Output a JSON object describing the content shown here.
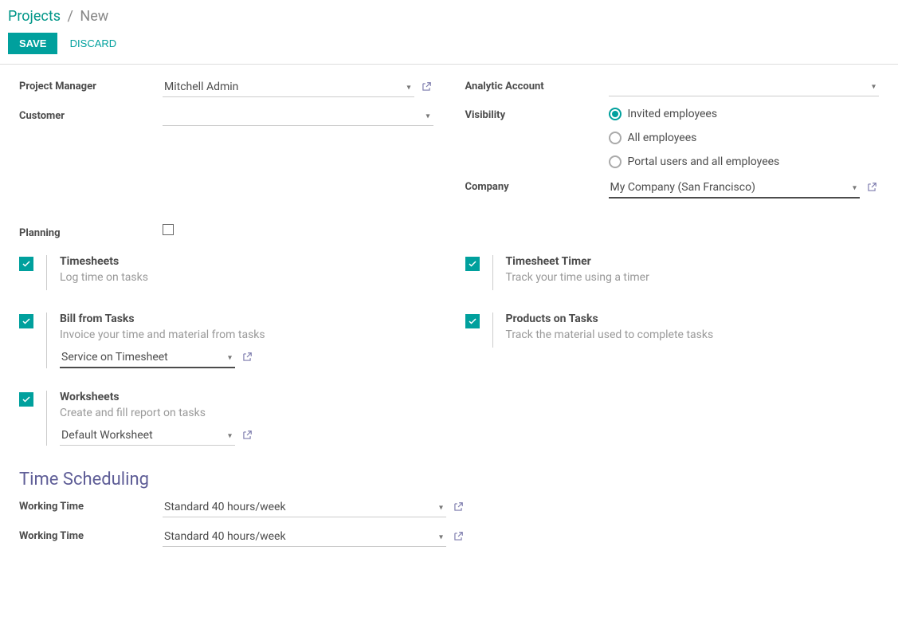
{
  "breadcrumb": {
    "root": "Projects",
    "current": "New"
  },
  "actions": {
    "save": "SAVE",
    "discard": "DISCARD"
  },
  "fields": {
    "project_manager_label": "Project Manager",
    "project_manager": "Mitchell Admin",
    "customer_label": "Customer",
    "customer": "",
    "analytic_account_label": "Analytic Account",
    "analytic_account": "",
    "visibility_label": "Visibility",
    "visibility_options": {
      "invited": "Invited employees",
      "all": "All employees",
      "portal": "Portal users and all employees"
    },
    "visibility_selected": "invited",
    "company_label": "Company",
    "company": "My Company (San Francisco)",
    "planning_label": "Planning"
  },
  "settings": {
    "timesheets": {
      "title": "Timesheets",
      "desc": "Log time on tasks"
    },
    "timesheet_timer": {
      "title": "Timesheet Timer",
      "desc": "Track your time using a timer"
    },
    "bill_from_tasks": {
      "title": "Bill from Tasks",
      "desc": "Invoice your time and material from tasks",
      "sub_value": "Service on Timesheet"
    },
    "products_on_tasks": {
      "title": "Products on Tasks",
      "desc": "Track the material used to complete tasks"
    },
    "worksheets": {
      "title": "Worksheets",
      "desc": "Create and fill report on tasks",
      "sub_value": "Default Worksheet"
    }
  },
  "time_scheduling": {
    "section_title": "Time Scheduling",
    "working_time_label": "Working Time",
    "working_time_value": "Standard 40 hours/week"
  }
}
